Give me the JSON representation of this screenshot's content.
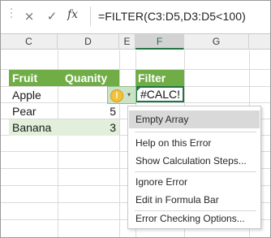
{
  "formula_bar": {
    "cancel_icon": "×",
    "enter_icon": "✓",
    "fx_label": "fx",
    "formula": "=FILTER(C3:D5,D3:D5<100)"
  },
  "columns": [
    "C",
    "D",
    "E",
    "F",
    "G"
  ],
  "selected_column": "F",
  "table": {
    "header_fruit": "Fruit",
    "header_quantity": "Quanity",
    "rows": [
      {
        "fruit": "Apple",
        "qty": "2"
      },
      {
        "fruit": "Pear",
        "qty": "5"
      },
      {
        "fruit": "Banana",
        "qty": "3"
      }
    ]
  },
  "filter_header": "Filter",
  "error_cell": "#CALC!",
  "smart_tag": {
    "warning_icon": "!",
    "dropdown_icon": "▾"
  },
  "context_menu": {
    "items": [
      "Empty Array",
      "Help on this Error",
      "Show Calculation Steps...",
      "Ignore Error",
      "Edit in Formula Bar",
      "Error Checking Options..."
    ]
  },
  "colors": {
    "header_green": "#70ad47",
    "data_light_green": "#e2efda",
    "selection_green": "#217346"
  }
}
